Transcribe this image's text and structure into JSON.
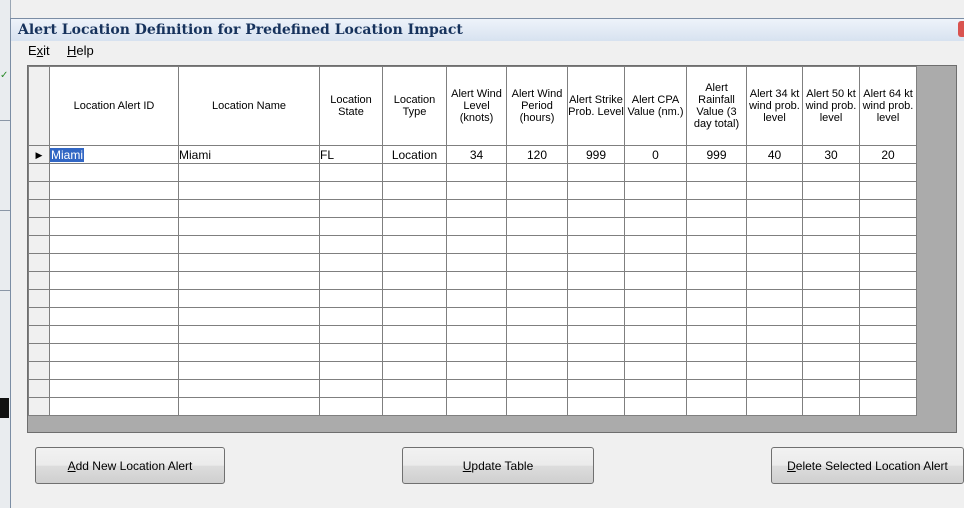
{
  "window": {
    "title": "Alert Location Definition for Predefined Location Impact"
  },
  "menu": [
    {
      "hotkey": "x",
      "label": "Exit",
      "pre": "E",
      "post": "it"
    },
    {
      "hotkey": "H",
      "label": "Help",
      "pre": "",
      "post": "elp"
    }
  ],
  "table": {
    "columns": [
      "Location Alert ID",
      "Location Name",
      "Location State",
      "Location Type",
      "Alert Wind Level (knots)",
      "Alert Wind Period (hours)",
      "Alert Strike Prob. Level",
      "Alert CPA Value (nm.)",
      "Alert Rainfall Value (3 day total)",
      "Alert 34 kt wind prob. level",
      "Alert 50 kt wind prob. level",
      "Alert 64 kt wind prob. level"
    ],
    "rows": [
      [
        "Miami",
        "Miami",
        "FL",
        "Location",
        "34",
        "120",
        "999",
        "0",
        "999",
        "40",
        "30",
        "20"
      ]
    ],
    "empty_rows": 14,
    "row_indicator": "▶"
  },
  "buttons": {
    "add": {
      "label": "Add New Location Alert",
      "hotkey": "A",
      "rest": "dd New Location Alert"
    },
    "update": {
      "label": "Update Table",
      "hotkey": "U",
      "rest": "pdate Table"
    },
    "delete": {
      "label": "Delete Selected Location Alert",
      "hotkey": "D",
      "rest": "elete Selected Location Alert"
    }
  }
}
